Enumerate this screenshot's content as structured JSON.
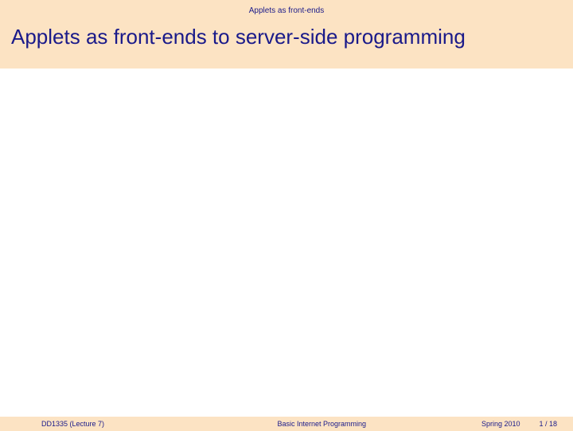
{
  "header": {
    "section_label": "Applets as front-ends",
    "title": "Applets as front-ends to server-side programming"
  },
  "footer": {
    "course": "DD1335 (Lecture 7)",
    "subject": "Basic Internet Programming",
    "term": "Spring 2010",
    "page": "1 / 18"
  }
}
